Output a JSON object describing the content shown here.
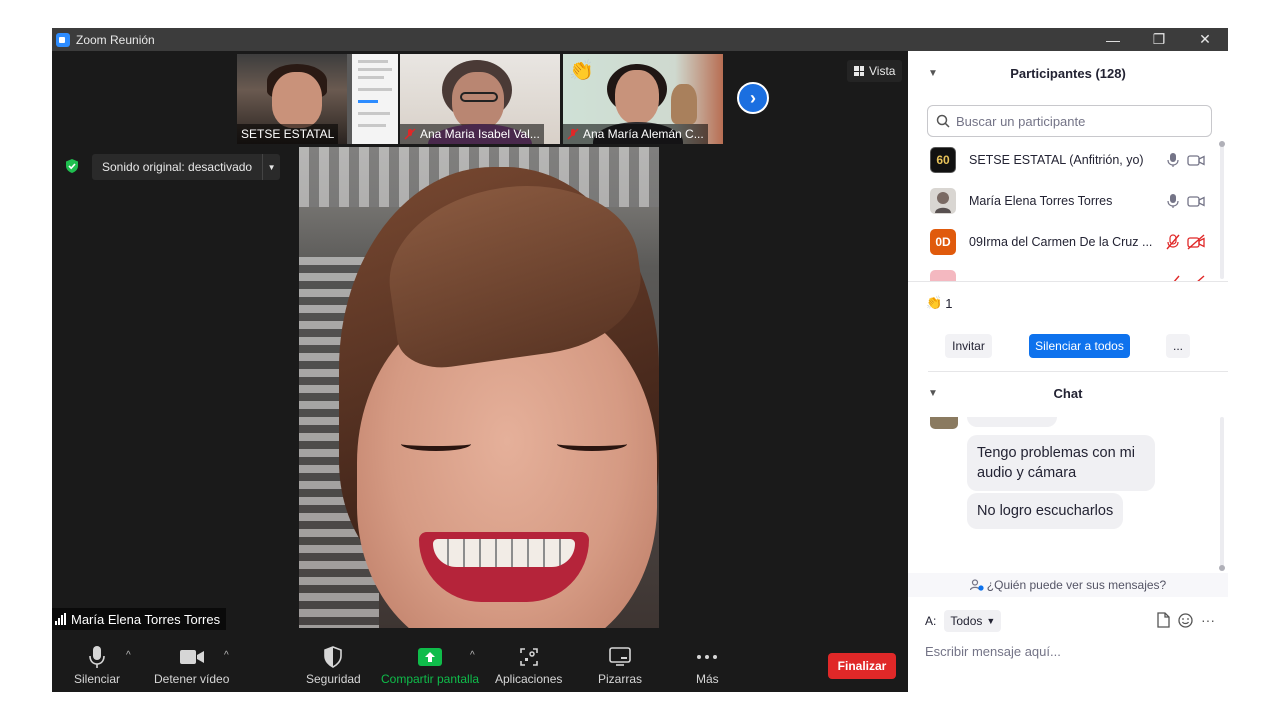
{
  "window": {
    "title": "Zoom Reunión",
    "minimize": "—",
    "restore": "❐",
    "close": "✕"
  },
  "video": {
    "view_label": "Vista",
    "original_sound": "Sonido original: desactivado",
    "thumbnails": [
      {
        "name": "SETSE ESTATAL"
      },
      {
        "name": "Ana Maria Isabel Val..."
      },
      {
        "name": "Ana María Alemán C..."
      }
    ],
    "active_speaker": "María Elena Torres Torres"
  },
  "toolbar": {
    "mute": "Silenciar",
    "stop_video": "Detener vídeo",
    "security": "Seguridad",
    "share": "Compartir pantalla",
    "apps": "Aplicaciones",
    "whiteboards": "Pizarras",
    "more": "Más",
    "end": "Finalizar",
    "share_color": "#0fbc4a",
    "end_color": "#e02828"
  },
  "participants": {
    "title": "Participantes (128)",
    "search_placeholder": "Buscar un participante",
    "list": [
      {
        "avatar": "60",
        "name": "SETSE ESTATAL (Anfitrión, yo)",
        "muted": false
      },
      {
        "avatar": "",
        "name": "María Elena Torres Torres",
        "muted": false
      },
      {
        "avatar": "0D",
        "name": "09Irma del Carmen De la Cruz ...",
        "muted": true
      }
    ],
    "raised_hands": "1",
    "invite": "Invitar",
    "mute_all": "Silenciar a todos",
    "more": "...",
    "accent_color": "#0e72ed"
  },
  "chat": {
    "title": "Chat",
    "messages": [
      "Tengo problemas con mi audio y cámara",
      "No logro escucharlos"
    ],
    "who_can_see": "¿Quién puede ver sus mensajes?",
    "to_label": "A:",
    "recipient": "Todos",
    "input_placeholder": "Escribir mensaje aquí...",
    "more_tools": "···"
  }
}
